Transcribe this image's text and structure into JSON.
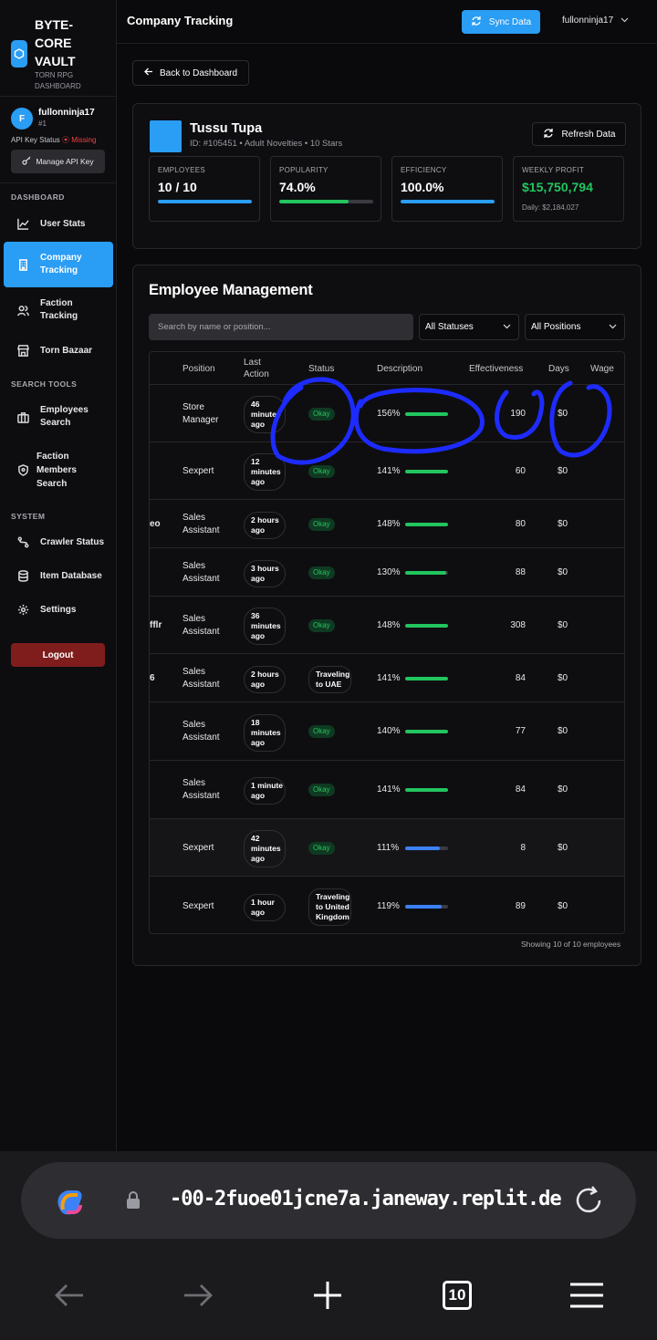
{
  "brand": {
    "title": "BYTE-CORE VAULT",
    "subtitle": "TORN RPG DASHBOARD"
  },
  "user": {
    "initial": "F",
    "name": "fullonninja17",
    "rank": "#1",
    "api_key_label": "API Key Status",
    "api_key_status": "Missing",
    "manage_label": "Manage API Key"
  },
  "sidebar": {
    "dashboard_label": "DASHBOARD",
    "items": [
      {
        "label": "User Stats"
      },
      {
        "label": "Company Tracking"
      },
      {
        "label": "Faction Tracking"
      },
      {
        "label": "Torn Bazaar"
      }
    ],
    "search_tools_label": "SEARCH TOOLS",
    "search_items": [
      {
        "label": "Employees Search"
      },
      {
        "label": "Faction Members Search"
      }
    ],
    "system_label": "SYSTEM",
    "system_items": [
      {
        "label": "Crawler Status"
      },
      {
        "label": "Item Database"
      },
      {
        "label": "Settings"
      }
    ],
    "logout_label": "Logout"
  },
  "header": {
    "title": "Company Tracking",
    "sync_label": "Sync Data",
    "username": "fullonninja17"
  },
  "back_label": "Back to Dashboard",
  "company": {
    "name": "Tussu Tupa",
    "meta": "ID: #105451 • Adult Novelties • 10 Stars",
    "refresh_label": "Refresh Data",
    "stats": [
      {
        "label": "EMPLOYEES",
        "value": "10 / 10",
        "fraction": 1.0,
        "color": "#2a9df4"
      },
      {
        "label": "POPULARITY",
        "value": "74.0%",
        "fraction": 0.74,
        "color": "#22c55e"
      },
      {
        "label": "EFFICIENCY",
        "value": "100.0%",
        "fraction": 1.0,
        "color": "#2a9df4"
      },
      {
        "label": "WEEKLY PROFIT",
        "value": "$15,750,794",
        "sub": "Daily: $2,184,027"
      }
    ]
  },
  "employees": {
    "title": "Employee Management",
    "search_placeholder": "Search by name or position...",
    "status_filter": "All Statuses",
    "position_filter": "All Positions",
    "columns": [
      "Position",
      "Last Action",
      "Status",
      "Description",
      "Effectiveness",
      "Days",
      "Wage"
    ],
    "rows": [
      {
        "name": "",
        "position": "Store Manager",
        "last_action": "46 minutes ago",
        "status": "Okay",
        "status_type": "okay",
        "desc": "156%",
        "eff": 1.0,
        "eff_color": "#22c55e",
        "days": "190",
        "wage": "$0"
      },
      {
        "name": "",
        "position": "Sexpert",
        "last_action": "12 minutes ago",
        "status": "Okay",
        "status_type": "okay",
        "desc": "141%",
        "eff": 1.0,
        "eff_color": "#22c55e",
        "days": "60",
        "wage": "$0"
      },
      {
        "name": "eo",
        "position": "Sales Assistant",
        "last_action": "2 hours ago",
        "status": "Okay",
        "status_type": "okay",
        "desc": "148%",
        "eff": 1.0,
        "eff_color": "#22c55e",
        "days": "80",
        "wage": "$0"
      },
      {
        "name": "",
        "position": "Sales Assistant",
        "last_action": "3 hours ago",
        "status": "Okay",
        "status_type": "okay",
        "desc": "130%",
        "eff": 0.95,
        "eff_color": "#22c55e",
        "days": "88",
        "wage": "$0"
      },
      {
        "name": "fflr",
        "position": "Sales Assistant",
        "last_action": "36 minutes ago",
        "status": "Okay",
        "status_type": "okay",
        "desc": "148%",
        "eff": 1.0,
        "eff_color": "#22c55e",
        "days": "308",
        "wage": "$0"
      },
      {
        "name": "6",
        "position": "Sales Assistant",
        "last_action": "2 hours ago",
        "status": "Traveling to UAE",
        "status_type": "travel",
        "desc": "141%",
        "eff": 1.0,
        "eff_color": "#22c55e",
        "days": "84",
        "wage": "$0"
      },
      {
        "name": "",
        "position": "Sales Assistant",
        "last_action": "18 minutes ago",
        "status": "Okay",
        "status_type": "okay",
        "desc": "140%",
        "eff": 1.0,
        "eff_color": "#22c55e",
        "days": "77",
        "wage": "$0"
      },
      {
        "name": "",
        "position": "Sales Assistant",
        "last_action": "1 minute ago",
        "status": "Okay",
        "status_type": "okay",
        "desc": "141%",
        "eff": 1.0,
        "eff_color": "#22c55e",
        "days": "84",
        "wage": "$0"
      },
      {
        "name": "",
        "position": "Sexpert",
        "last_action": "42 minutes ago",
        "status": "Okay",
        "status_type": "okay",
        "desc": "111%",
        "eff": 0.8,
        "eff_color": "#3b82f6",
        "days": "8",
        "wage": "$0"
      },
      {
        "name": "",
        "position": "Sexpert",
        "last_action": "1 hour ago",
        "status": "Traveling to United Kingdom",
        "status_type": "travel",
        "desc": "119%",
        "eff": 0.85,
        "eff_color": "#3b82f6",
        "days": "89",
        "wage": "$0"
      }
    ],
    "footer": "Showing 10 of 10 employees"
  },
  "browser": {
    "url": "-00-2fuoe01jcne7a.janeway.replit.de",
    "tab_count": "10"
  }
}
